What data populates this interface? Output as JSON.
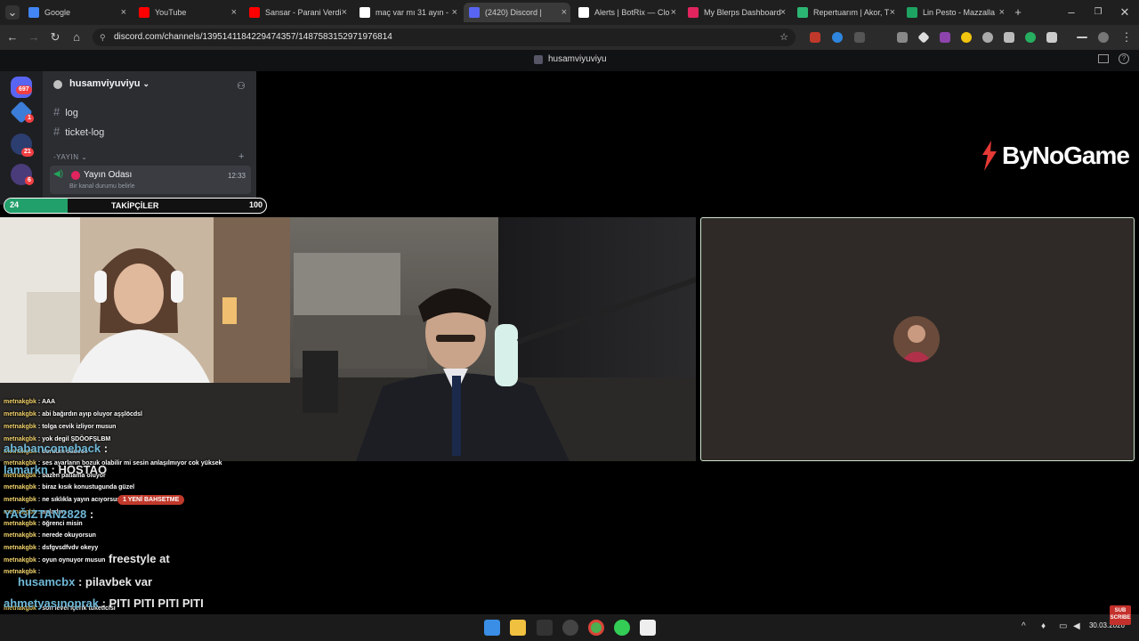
{
  "browser": {
    "tabs": [
      {
        "label": "Google",
        "color": "#4285f4",
        "active": false
      },
      {
        "label": "YouTube",
        "color": "#ff0000",
        "active": false
      },
      {
        "label": "Sansar - Parani Verdi",
        "color": "#ff0000",
        "active": false
      },
      {
        "label": "maç var mı 31 ayın -",
        "color": "#ffffff",
        "active": false
      },
      {
        "label": "(2420) Discord | ",
        "color": "#5865f2",
        "active": true
      },
      {
        "label": "Alerts | BotRix — Clo",
        "color": "#ffffff",
        "active": false
      },
      {
        "label": "My Blerps Dashboard",
        "color": "#e0245e",
        "active": false
      },
      {
        "label": "Repertuarım | Akor, T",
        "color": "#2bb673",
        "active": false
      },
      {
        "label": "Lin Pesto - Mazzalla",
        "color": "#1da462",
        "active": false
      }
    ],
    "url": "discord.com/channels/1395141184229474357/1487583152971976814"
  },
  "window_title": "husamviyuviyu",
  "discord": {
    "server_name": "husamviyuviyu",
    "guild_badges": [
      "697",
      "1",
      "21",
      "6"
    ],
    "channels": [
      {
        "name": "log"
      },
      {
        "name": "ticket-log"
      }
    ],
    "category": "-YAYIN",
    "voice_channel": {
      "name": "Yayın Odası",
      "time": "12:33",
      "status": "Bir kanal durumu belirle"
    }
  },
  "followers": {
    "current": "24",
    "label": "TAKİPÇİLER",
    "goal": "100",
    "progress": 0.24,
    "color": "#22a06b"
  },
  "brand": {
    "name": "ByNoGame"
  },
  "chat": {
    "messages": [
      {
        "user": "metnakgbk",
        "text": ": AAA"
      },
      {
        "user": "metnakgbk",
        "text": ": abi bağırdın ayıp oluyor aşşlöcdsl"
      },
      {
        "user": "metnakgbk",
        "text": ": tolga cevik izliyor musun"
      },
      {
        "user": "metnakgbk",
        "text": ": yok degil ŞDÖOFŞLBM"
      },
      {
        "user": "metnakgbk",
        "text": ": sordum sadece"
      },
      {
        "user": "metnakgbk",
        "text": ": ses ayarların bozuk olabilir mi sesin anlaşılmıyor cok yüksek"
      },
      {
        "user": "metnakgbk",
        "text": ": bazen patlama oluyor"
      },
      {
        "user": "metnakgbk",
        "text": ": biraz kısık konustugunda güzel"
      },
      {
        "user": "metnakgbk",
        "text": ": ne sıklıkla yayın acıyorsun"
      },
      {
        "user": "metnakgbk",
        "text": ": anladım"
      },
      {
        "user": "metnakgbk",
        "text": ": öğrenci misin"
      },
      {
        "user": "metnakgbk",
        "text": ": nerede okuyorsun"
      },
      {
        "user": "metnakgbk",
        "text": ": dsfgvsdfvdv okeyy"
      },
      {
        "user": "metnakgbk",
        "text": ": oyun oynuyor musun"
      },
      {
        "user": "metnakgbk",
        "text": ":"
      },
      {
        "user": "metnakgbk",
        "text": ": son level içerik tuketiclsi"
      }
    ],
    "big_messages": [
      {
        "user": "ababancomeback",
        "text": ":"
      },
      {
        "user": "lamarkn",
        "text": ": HOSTAO"
      },
      {
        "user": "YAĞIZTAN2828",
        "text": ":"
      },
      {
        "user": "",
        "text": "freestyle at"
      },
      {
        "user": "husamcbx",
        "text": ": pilavbek var"
      },
      {
        "user": "ahmetyasınoprak",
        "text": ": PITI PITI PITI PITI"
      },
      {
        "user": "",
        "text": "PITI PITI"
      }
    ],
    "highlight_badge": "1 YENİ BAHSETME"
  },
  "voice_tile": {
    "border_color": "#cfe6cf"
  },
  "taskbar": {
    "date": "30.03.2026"
  },
  "subscribe": {
    "label_1": "SUB",
    "label_2": "SCRIBE"
  }
}
